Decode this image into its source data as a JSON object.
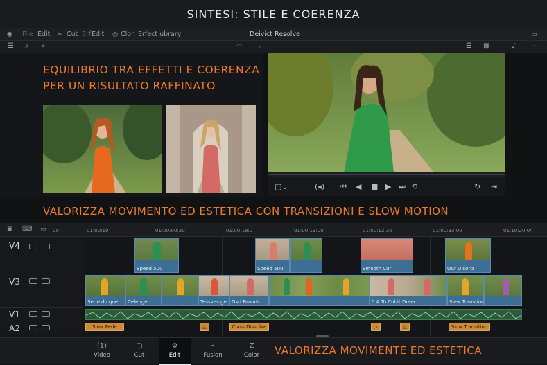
{
  "header_title": "SINTESI: STILE E COERENZA",
  "menubar": {
    "items": [
      "File",
      "Edit",
      "Cut",
      "Erf",
      "Edit",
      "Clor",
      "Erfect ubrary"
    ],
    "app_title": "Deivict Resolve"
  },
  "left_panel": {
    "headline_line1": "EQUILIBRIO TRA EFFETTI E COERENZA",
    "headline_line2": "PER UN RISULTATO RAFFINATO"
  },
  "banner_middle": "VALORIZZA MOVIMENTO ED ESTETICA CON TRANSIZIONI E SLOW MOTION",
  "banner_bottom": "VALORIZZA MOVIMENTE ED ESTETICA",
  "ruler": {
    "ticks": [
      "01:00:10",
      "01:00:00:30",
      "01:00:18:0",
      "01:00:13:00",
      "01:00:12:30",
      "01:00:33:00",
      "01:10:20:04"
    ],
    "track_label_small": "00"
  },
  "tracks": {
    "v4": {
      "name": "V4",
      "clips": [
        "Speed 500",
        "Speed 500",
        "",
        "Smooth Cur",
        "Our Disoriz"
      ]
    },
    "v3": {
      "name": "V3",
      "clips": [
        "Serie do que...",
        "Celenge.",
        "",
        "Tessves ge...",
        "Osri Brands.",
        "",
        "0 A To Cuhit Dreec...",
        "",
        "Slew Transtion",
        ""
      ]
    },
    "v1": {
      "name": "V1"
    },
    "a2": {
      "name": "A2",
      "transitions": [
        "Slow Pede",
        "",
        "Class Dissolve",
        "",
        "",
        "Slow Transition"
      ]
    }
  },
  "pages": [
    {
      "label": "Video",
      "icon": "(1)"
    },
    {
      "label": "Cut",
      "icon": "▢"
    },
    {
      "label": "Edit",
      "icon": "⚙"
    },
    {
      "label": "Fusion",
      "icon": "⌁"
    },
    {
      "label": "Color",
      "icon": "Z"
    }
  ],
  "active_page": "Edit",
  "colors": {
    "accent_orange": "#ec7a2d",
    "clip_blue": "#3d6f94",
    "audio_green": "#2c5a3b",
    "transition_gold": "#c98a3a"
  }
}
